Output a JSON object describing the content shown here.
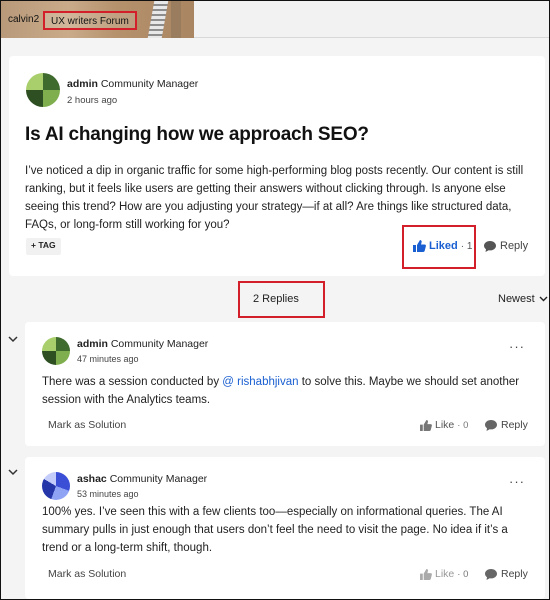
{
  "topbar": {
    "user": "calvin2",
    "forum": "UX writers Forum"
  },
  "post": {
    "author": "admin",
    "role": "Community Manager",
    "time": "2 hours ago",
    "title": "Is AI changing how we approach SEO?",
    "body": "I’ve noticed a dip in organic traffic for some high-performing blog posts recently. Our content is still ranking, but it feels like users are getting their answers without clicking through. Is anyone else seeing this trend? How are you adjusting your strategy—if at all? Are things like structured data, FAQs, or long-form still working for you?",
    "tag_label": "+ TAG",
    "liked_label": "Liked",
    "like_count": "· 1",
    "reply_label": "Reply"
  },
  "replies_bar": {
    "count_label": "2 Replies",
    "sort_label": "Newest"
  },
  "replies": [
    {
      "author": "admin",
      "role": "Community Manager",
      "time": "47 minutes ago",
      "text_before": "There was a session conducted by ",
      "mention": "@ rishabhjivan",
      "text_after": " to solve this. Maybe we should set another session with the Analytics teams.",
      "mark_solution": "Mark as Solution",
      "like_label": "Like",
      "like_count": "· 0",
      "reply_label": "Reply",
      "more_label": "···"
    },
    {
      "author": "ashac",
      "role": "Community Manager",
      "time": "53 minutes ago",
      "text": "100% yes. I’ve seen this with a few clients too—especially on informational queries. The AI summary pulls in just enough that users don’t feel the need to visit the page. No idea if it’s a trend or a long-term shift, though.",
      "mark_solution": "Mark as Solution",
      "like_label": "Like",
      "like_count": "· 0",
      "reply_label": "Reply",
      "more_label": "···"
    }
  ],
  "colors": {
    "highlight_border": "#d21f2a",
    "link_blue": "#1a5fd1",
    "page_bg": "#f4f4f4",
    "card_bg": "#ffffff"
  },
  "icons": {
    "thumbs_up": "thumbs-up-icon",
    "speech_bubble": "speech-bubble-icon",
    "chevron": "chevron-down-icon",
    "more": "more-dots-icon"
  }
}
